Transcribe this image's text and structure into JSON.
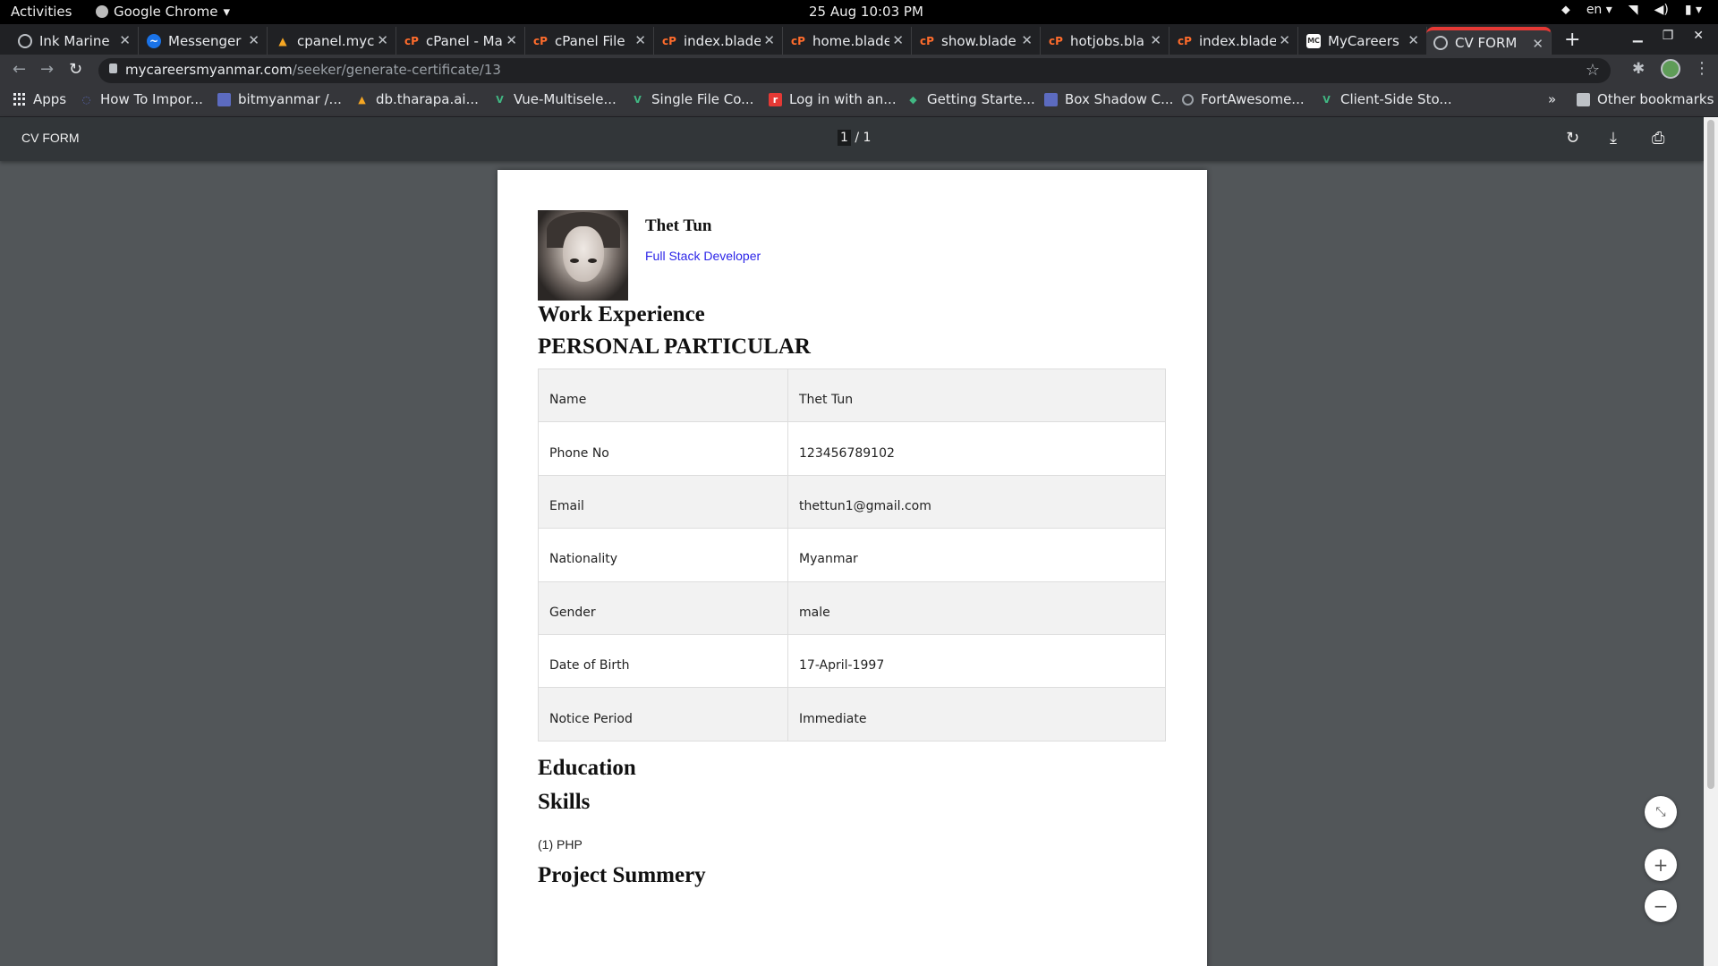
{
  "system": {
    "activities": "Activities",
    "app_name": "Google Chrome",
    "clock": "25 Aug  10:03 PM",
    "lang": "en"
  },
  "tabs": [
    {
      "title": "Ink Marine",
      "icon": "globe-icon"
    },
    {
      "title": "Messenger",
      "icon": "messenger-icon"
    },
    {
      "title": "cpanel.myc",
      "icon": "warning-icon"
    },
    {
      "title": "cPanel - Ma",
      "icon": "cpanel-icon"
    },
    {
      "title": "cPanel File",
      "icon": "cpanel-icon"
    },
    {
      "title": "index.blade",
      "icon": "cpanel-icon"
    },
    {
      "title": "home.blade",
      "icon": "cpanel-icon"
    },
    {
      "title": "show.blade",
      "icon": "cpanel-icon"
    },
    {
      "title": "hotjobs.bla",
      "icon": "cpanel-icon"
    },
    {
      "title": "index.blade",
      "icon": "cpanel-icon"
    },
    {
      "title": "MyCareers",
      "icon": "mycareers-icon"
    },
    {
      "title": "CV FORM",
      "icon": "globe-icon",
      "active": true
    }
  ],
  "omnibox": {
    "host": "mycareersmyanmar.com",
    "path": "/seeker/generate-certificate/13"
  },
  "bookmarks": [
    {
      "label": "Apps",
      "icon": "apps-grid-icon"
    },
    {
      "label": "How To Impor...",
      "icon": "loader-icon"
    },
    {
      "label": "bitmyanmar /...",
      "icon": "bitbucket-icon"
    },
    {
      "label": "db.tharapa.ai...",
      "icon": "warning-icon"
    },
    {
      "label": "Vue-Multisele...",
      "icon": "vue-icon"
    },
    {
      "label": "Single File Co...",
      "icon": "vue-icon"
    },
    {
      "label": "Log in with an...",
      "icon": "laravel-icon"
    },
    {
      "label": "Getting Starte...",
      "icon": "shield-icon"
    },
    {
      "label": "Box Shadow C...",
      "icon": "box-icon"
    },
    {
      "label": "FortAwesome...",
      "icon": "github-icon"
    },
    {
      "label": "Client-Side Sto...",
      "icon": "vue-icon"
    }
  ],
  "other_bookmarks": "Other bookmarks",
  "pdf": {
    "title": "CV FORM",
    "page_current": "1",
    "page_total": "/ 1"
  },
  "cv": {
    "name": "Thet Tun",
    "role": "Full Stack Developer",
    "work_heading": "Work Experience",
    "personal_heading": "PERSONAL PARTICULAR",
    "particulars": [
      {
        "label": "Name",
        "value": "Thet Tun"
      },
      {
        "label": "Phone No",
        "value": "123456789102"
      },
      {
        "label": "Email",
        "value": "thettun1@gmail.com"
      },
      {
        "label": "Nationality",
        "value": "Myanmar"
      },
      {
        "label": "Gender",
        "value": "male"
      },
      {
        "label": "Date of Birth",
        "value": "17-April-1997"
      },
      {
        "label": "Notice Period",
        "value": "Immediate"
      }
    ],
    "education_heading": "Education",
    "skills_heading": "Skills",
    "skills": [
      "(1) PHP"
    ],
    "project_heading": "Project Summery"
  }
}
